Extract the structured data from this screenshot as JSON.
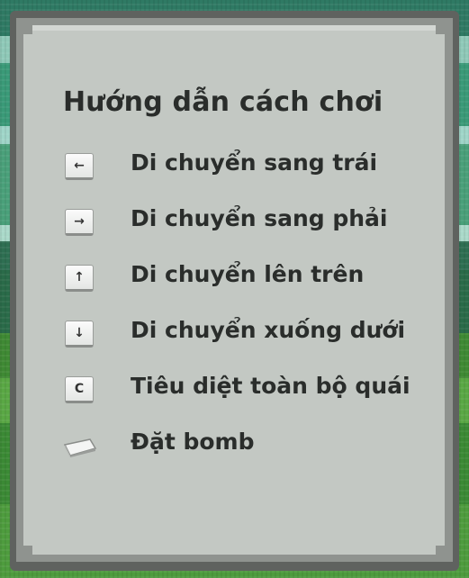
{
  "panel": {
    "title": "Hướng dẫn cách chơi"
  },
  "controls": [
    {
      "key": "←",
      "icon": "arrow-left-key-icon",
      "label": "Di chuyển sang trái"
    },
    {
      "key": "→",
      "icon": "arrow-right-key-icon",
      "label": "Di chuyển sang phải"
    },
    {
      "key": "↑",
      "icon": "arrow-up-key-icon",
      "label": "Di chuyển lên trên"
    },
    {
      "key": "↓",
      "icon": "arrow-down-key-icon",
      "label": "Di chuyển xuống dưới"
    },
    {
      "key": "C",
      "icon": "c-key-icon",
      "label": "Tiêu diệt toàn bộ quái"
    },
    {
      "key": "",
      "icon": "spacebar-key-icon",
      "label": "Đặt bomb"
    }
  ],
  "colors": {
    "panel_face": "#c3c8c3",
    "panel_border": "#5f625f",
    "text": "#2a2d2b"
  }
}
